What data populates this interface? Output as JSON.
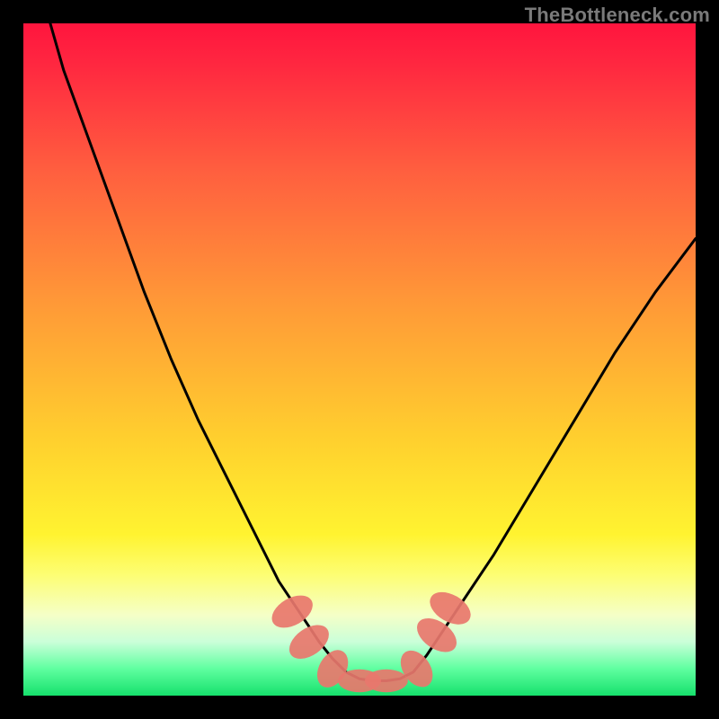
{
  "watermark": "TheBottleneck.com",
  "chart_data": {
    "type": "line",
    "title": "",
    "xlabel": "",
    "ylabel": "",
    "xlim": [
      0,
      100
    ],
    "ylim": [
      0,
      100
    ],
    "grid": false,
    "series": [
      {
        "name": "curve",
        "color": "#000000",
        "x": [
          4,
          6,
          10,
          14,
          18,
          22,
          26,
          30,
          34,
          38,
          40,
          42,
          44,
          46,
          48,
          50,
          52,
          54,
          56,
          58,
          60,
          64,
          70,
          76,
          82,
          88,
          94,
          100
        ],
        "y": [
          100,
          93,
          82,
          71,
          60,
          50,
          41,
          33,
          25,
          17,
          14,
          11,
          8,
          5.5,
          3.5,
          2.5,
          2.2,
          2.2,
          2.5,
          3.5,
          6,
          12,
          21,
          31,
          41,
          51,
          60,
          68
        ]
      }
    ],
    "markers": [
      {
        "shape": "pill",
        "x": 40.0,
        "y": 12.5,
        "rx": 2.0,
        "ry": 3.3,
        "angle": 60
      },
      {
        "shape": "pill",
        "x": 42.5,
        "y": 8.0,
        "rx": 2.0,
        "ry": 3.3,
        "angle": 55
      },
      {
        "shape": "pill",
        "x": 46.0,
        "y": 4.0,
        "rx": 2.0,
        "ry": 3.0,
        "angle": 30
      },
      {
        "shape": "pill",
        "x": 50.0,
        "y": 2.2,
        "rx": 3.2,
        "ry": 1.7,
        "angle": 0
      },
      {
        "shape": "pill",
        "x": 54.0,
        "y": 2.2,
        "rx": 3.2,
        "ry": 1.7,
        "angle": 0
      },
      {
        "shape": "pill",
        "x": 58.5,
        "y": 4.0,
        "rx": 2.0,
        "ry": 3.0,
        "angle": -35
      },
      {
        "shape": "pill",
        "x": 61.5,
        "y": 9.0,
        "rx": 2.0,
        "ry": 3.3,
        "angle": -55
      },
      {
        "shape": "pill",
        "x": 63.5,
        "y": 13.0,
        "rx": 2.0,
        "ry": 3.3,
        "angle": -60
      }
    ],
    "marker_style": {
      "fill": "#e8776d",
      "opacity": 0.92
    }
  }
}
